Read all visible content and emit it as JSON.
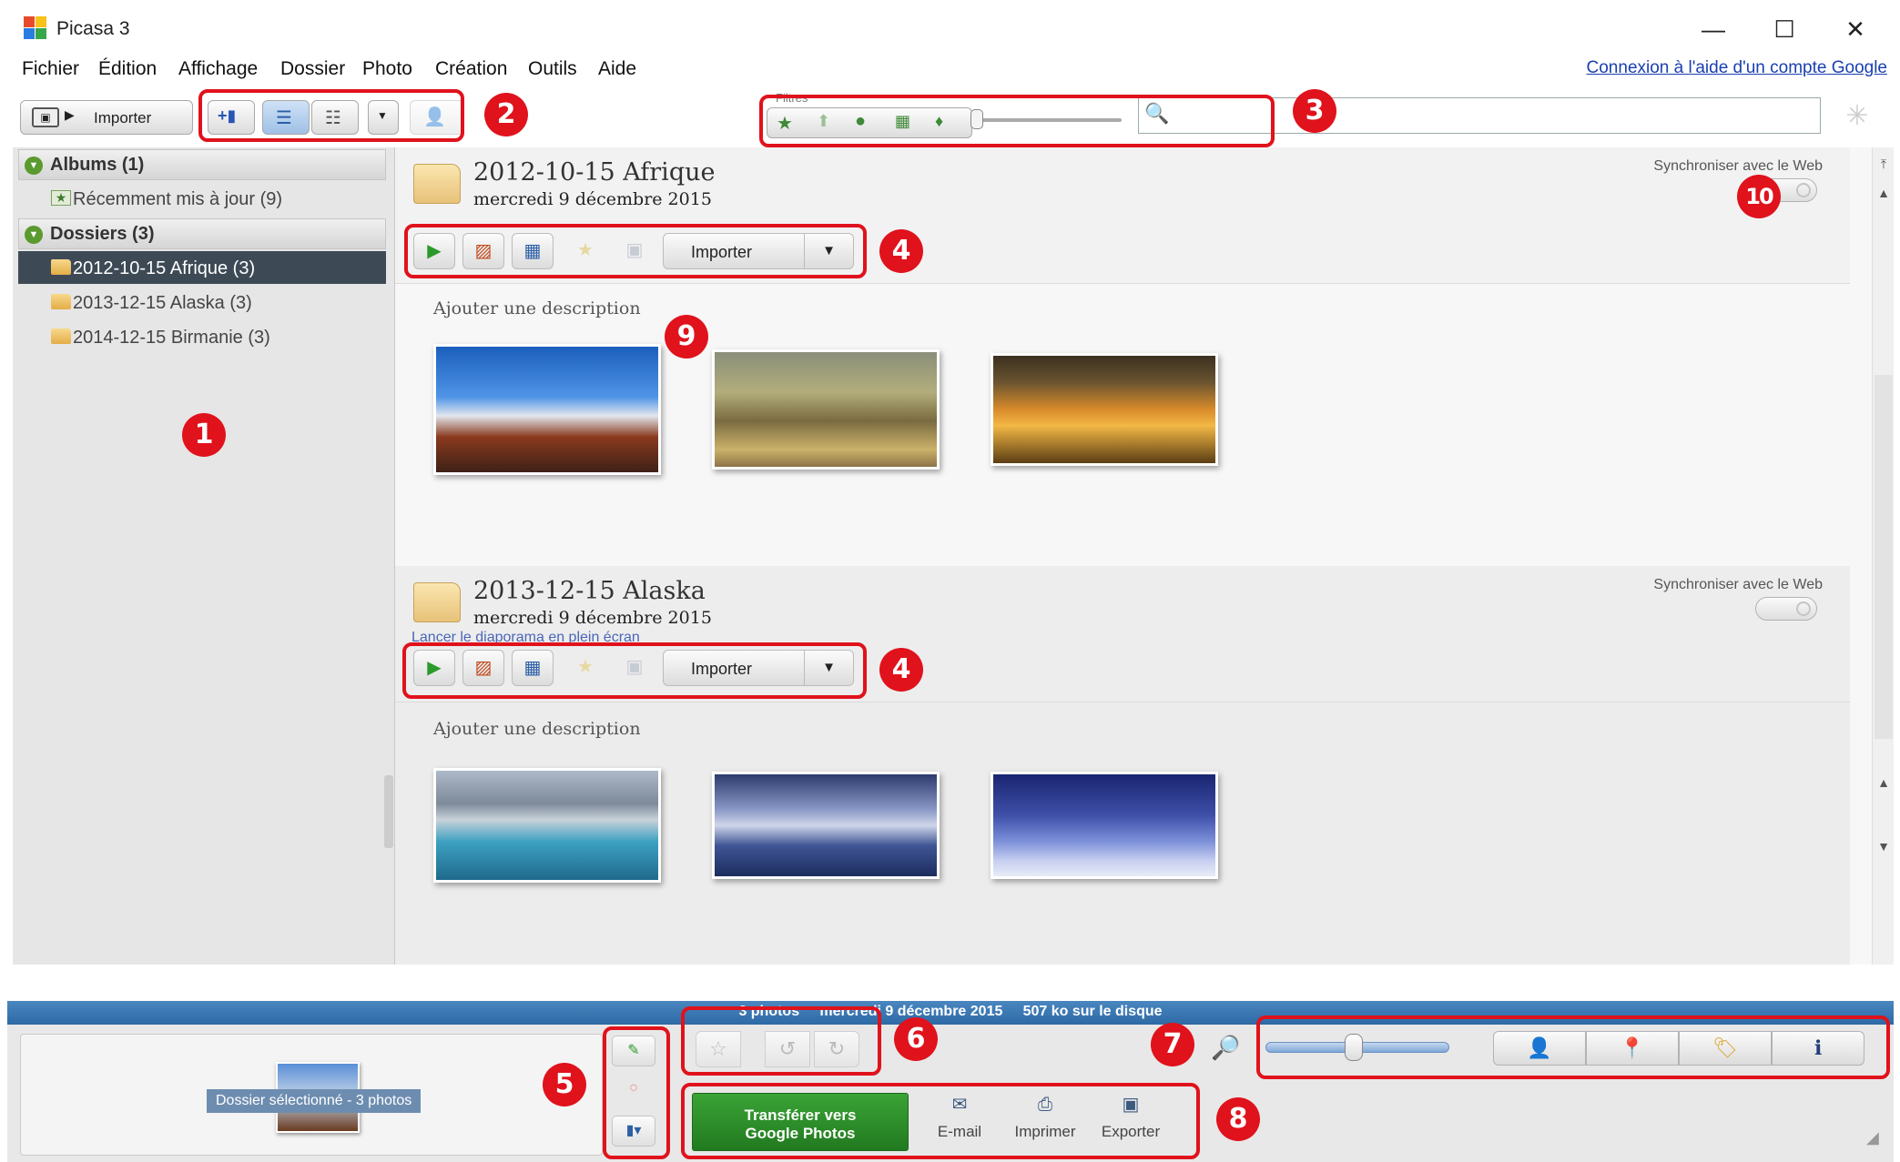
{
  "window": {
    "title": "Picasa 3",
    "minimize": "—",
    "maximize": "☐",
    "close": "✕"
  },
  "menu": [
    "Fichier",
    "Édition",
    "Affichage",
    "Dossier",
    "Photo",
    "Création",
    "Outils",
    "Aide"
  ],
  "google_link": "Connexion à l'aide d'un compte Google",
  "toolbar": {
    "import_label": "Importer",
    "filters_label": "Filtres"
  },
  "sidebar": {
    "albums_header": "Albums (1)",
    "albums": [
      {
        "label": "Récemment mis à jour (9)"
      }
    ],
    "folders_header": "Dossiers (3)",
    "folders": [
      {
        "label": "2012-10-15 Afrique (3)",
        "selected": true
      },
      {
        "label": "2013-12-15 Alaska (3)",
        "selected": false
      },
      {
        "label": "2014-12-15 Birmanie (3)",
        "selected": false
      }
    ]
  },
  "folders": [
    {
      "title": "2012-10-15 Afrique",
      "date": "mercredi 9 décembre 2015",
      "sync_label": "Synchroniser avec le Web",
      "import_label": "Importer",
      "add_description": "Ajouter une description",
      "photos": [
        "dance",
        "giraffe",
        "sunset"
      ]
    },
    {
      "title": "2013-12-15 Alaska",
      "date": "mercredi 9 décembre 2015",
      "sync_label": "Synchroniser avec le Web",
      "slideshow_hint": "Lancer le diaporama en plein écran",
      "import_label": "Importer",
      "add_description": "Ajouter une description",
      "photos": [
        "lake",
        "whale",
        "sled-dogs"
      ]
    }
  ],
  "status": {
    "photos_count": "3 photos",
    "date": "mercredi 9 décembre 2015",
    "disk": "507 ko sur le disque"
  },
  "tray": {
    "caption": "Dossier sélectionné - 3 photos",
    "upload_line1": "Transférer vers",
    "upload_line2": "Google Photos",
    "email": "E-mail",
    "print": "Imprimer",
    "export": "Exporter"
  },
  "annotations": [
    "1",
    "2",
    "3",
    "4",
    "4",
    "5",
    "6",
    "7",
    "8",
    "9",
    "10"
  ],
  "colors": {
    "annotation_red": "#e0121c",
    "selected_item": "#3d4a56",
    "upload_green": "#2e8f2b",
    "status_blue": "#3a78b4"
  }
}
